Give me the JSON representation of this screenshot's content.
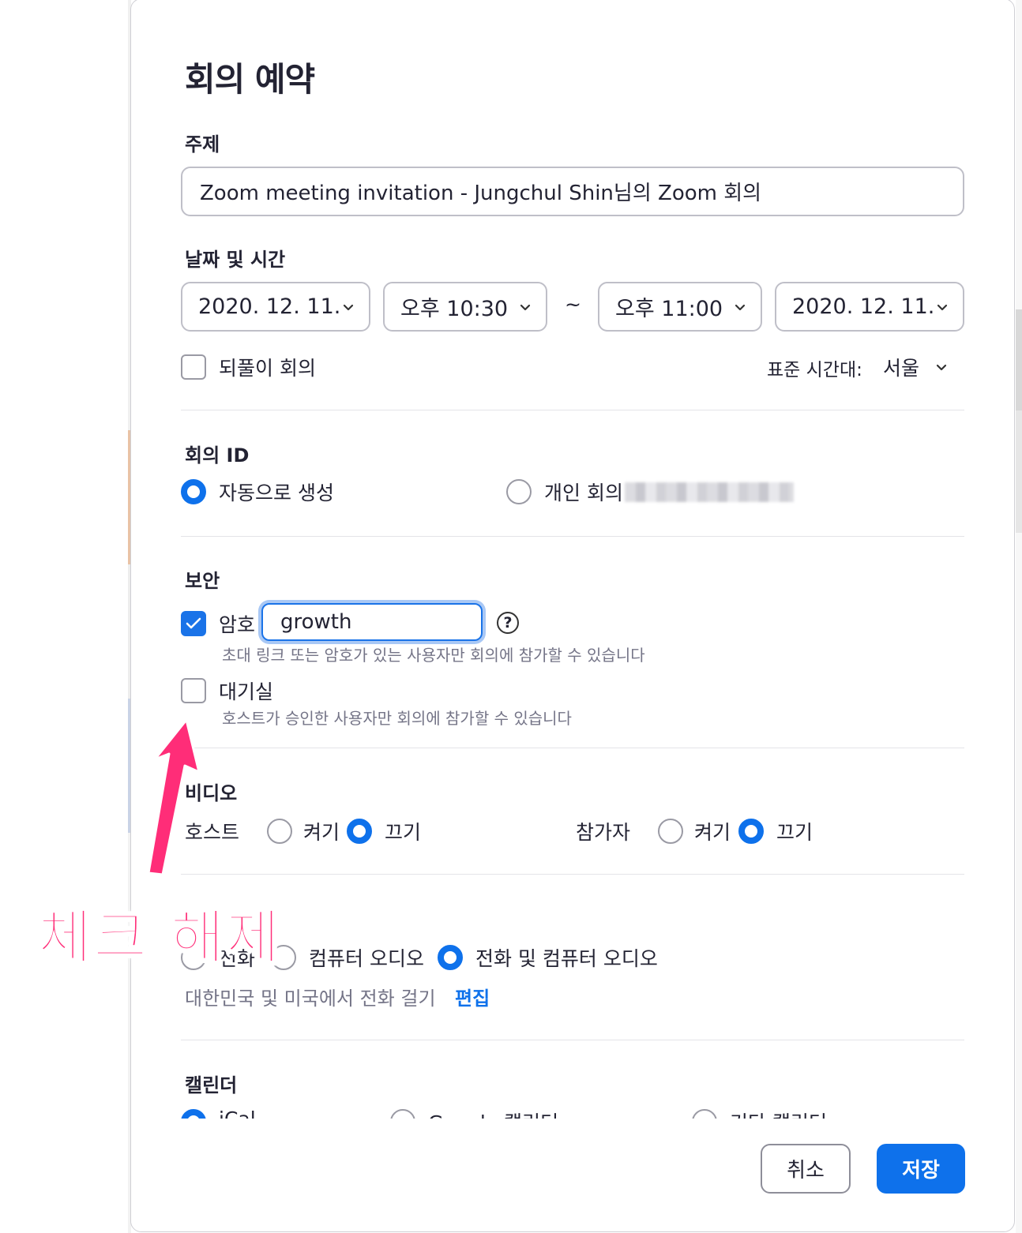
{
  "dialog": {
    "title": "회의 예약",
    "topic": {
      "label": "주제",
      "value": "Zoom meeting invitation - Jungchul Shin님의 Zoom 회의"
    },
    "datetime": {
      "label": "날짜 및 시간",
      "start_date": "2020. 12.  11.",
      "start_time": "오후 10:30",
      "separator": "~",
      "end_time": "오후 11:00",
      "end_date": "2020. 12.  11.",
      "recurring_label": "되풀이 회의",
      "recurring_checked": false,
      "timezone_label": "표준 시간대:",
      "timezone_value": "서울"
    },
    "meeting_id": {
      "label": "회의 ID",
      "auto_label": "자동으로 생성",
      "personal_label": "개인 회의",
      "selected": "auto"
    },
    "security": {
      "label": "보안",
      "password_label": "암호",
      "password_checked": true,
      "password_value": "growth",
      "help_symbol": "?",
      "password_hint": "초대 링크 또는 암호가 있는 사용자만 회의에 참가할 수 있습니다",
      "waiting_room_label": "대기실",
      "waiting_room_checked": false,
      "waiting_room_hint": "호스트가 승인한 사용자만 회의에 참가할 수 있습니다"
    },
    "video": {
      "label": "비디오",
      "host_label": "호스트",
      "participant_label": "참가자",
      "on_label": "켜기",
      "off_label": "끄기",
      "host_selected": "off",
      "participant_selected": "off"
    },
    "audio": {
      "phone_label": "전화",
      "computer_label": "컴퓨터 오디오",
      "both_label": "전화 및 컴퓨터 오디오",
      "selected": "both",
      "dial_info": "대한민국 및 미국에서 전화 걸기",
      "edit_label": "편집"
    },
    "calendar": {
      "label": "캘린더",
      "ical_label": "iCal",
      "google_label": "Google 캘린더",
      "other_label": "기타 캘린더",
      "selected": "ical"
    },
    "buttons": {
      "cancel": "취소",
      "save": "저장"
    }
  },
  "annotation": {
    "text": "체크 해제",
    "color": "#ff2d78"
  },
  "colors": {
    "accent": "#0e71eb",
    "annotation": "#ff2d78"
  }
}
